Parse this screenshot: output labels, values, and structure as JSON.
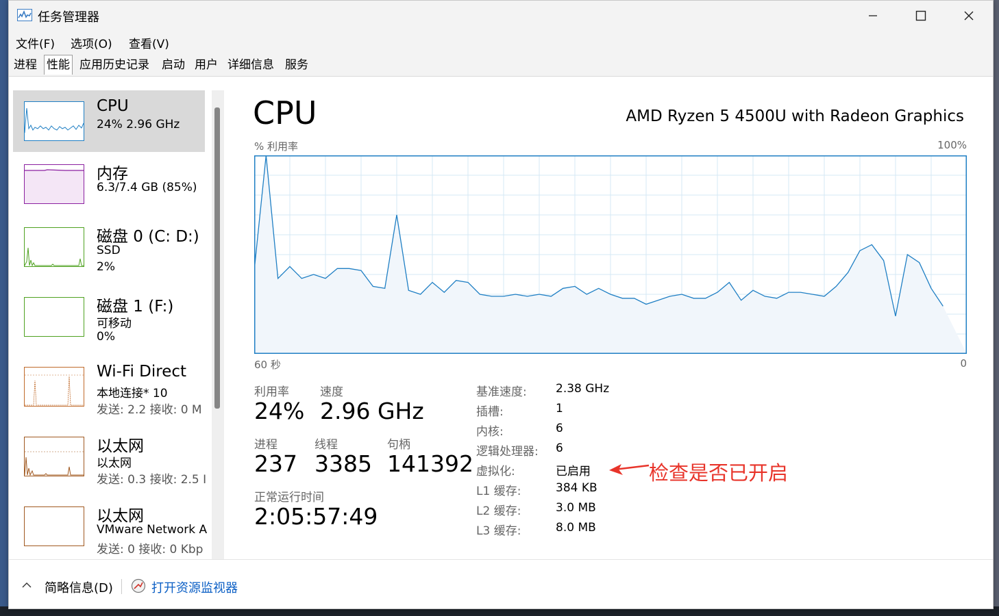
{
  "window": {
    "title": "任务管理器",
    "controls": [
      "minimize-icon",
      "maximize-icon",
      "close-icon"
    ]
  },
  "menu": [
    {
      "label": "文件(F)"
    },
    {
      "label": "选项(O)"
    },
    {
      "label": "查看(V)"
    }
  ],
  "tabs": [
    {
      "label": "进程"
    },
    {
      "label": "性能",
      "active": true
    },
    {
      "label": "应用历史记录"
    },
    {
      "label": "启动"
    },
    {
      "label": "用户"
    },
    {
      "label": "详细信息"
    },
    {
      "label": "服务"
    }
  ],
  "sidebar": {
    "items": [
      {
        "name": "CPU",
        "line1": "24%  2.96 GHz",
        "line2": "",
        "color": "#1f7fc4",
        "selected": true
      },
      {
        "name": "内存",
        "line1": "6.3/7.4 GB (85%)",
        "line2": "",
        "color": "#8b1fa0"
      },
      {
        "name": "磁盘 0 (C: D:)",
        "line1": "SSD",
        "line2": "2%",
        "color": "#4ea11f"
      },
      {
        "name": "磁盘 1 (F:)",
        "line1": "可移动",
        "line2": "0%",
        "color": "#4ea11f"
      },
      {
        "name": "Wi-Fi Direct",
        "line1": "本地连接* 10",
        "line2": "发送: 2.2  接收: 0 M",
        "color": "#c06a2a"
      },
      {
        "name": "以太网",
        "line1": "以太网",
        "line2": "发送: 0.3  接收: 2.5 I",
        "color": "#a0581f"
      },
      {
        "name": "以太网",
        "line1": "VMware Network A",
        "line2": "发送: 0  接收: 0 Kbp",
        "color": "#a0581f"
      }
    ]
  },
  "main": {
    "title": "CPU",
    "model": "AMD Ryzen 5 4500U with Radeon Graphics",
    "graph": {
      "y_label": "% 利用率",
      "y_max_label": "100%",
      "x_left_label": "60 秒",
      "x_right_label": "0",
      "line_color": "#1f7fc4",
      "fill_color": "#f1f6fb",
      "grid_color": "#d6e8f4"
    },
    "stats": {
      "util_label": "利用率",
      "util_value": "24%",
      "speed_label": "速度",
      "speed_value": "2.96 GHz",
      "proc_label": "进程",
      "proc_value": "237",
      "thread_label": "线程",
      "thread_value": "3385",
      "handle_label": "句柄",
      "handle_value": "141392",
      "uptime_label": "正常运行时间",
      "uptime_value": "2:05:57:49"
    },
    "details": [
      {
        "key": "基准速度:",
        "value": "2.38 GHz"
      },
      {
        "key": "插槽:",
        "value": "1"
      },
      {
        "key": "内核:",
        "value": "6"
      },
      {
        "key": "逻辑处理器:",
        "value": "6"
      },
      {
        "key": "虚拟化:",
        "value": "已启用"
      },
      {
        "key": "L1 缓存:",
        "value": "384 KB"
      },
      {
        "key": "L2 缓存:",
        "value": "3.0 MB"
      },
      {
        "key": "L3 缓存:",
        "value": "8.0 MB"
      }
    ],
    "annotation": {
      "text": "检查是否已开启",
      "color": "#e8342a"
    }
  },
  "footer": {
    "fewer_details": "简略信息(D)",
    "open_monitor": "打开资源监视器"
  },
  "chart_data": {
    "type": "area",
    "x": [
      60,
      59,
      58,
      57,
      56,
      55,
      54,
      53,
      52,
      51,
      50,
      49,
      48,
      47,
      46,
      45,
      44,
      43,
      42,
      41,
      40,
      39,
      38,
      37,
      36,
      35,
      34,
      33,
      32,
      31,
      30,
      29,
      28,
      27,
      26,
      25,
      24,
      23,
      22,
      21,
      20,
      19,
      18,
      17,
      16,
      15,
      14,
      13,
      12,
      11,
      10,
      9,
      8,
      7,
      6,
      5,
      4,
      3,
      2,
      1,
      0
    ],
    "values": [
      42,
      100,
      38,
      44,
      38,
      40,
      38,
      43,
      43,
      42,
      34,
      33,
      70,
      32,
      30,
      36,
      31,
      37,
      36,
      30,
      29,
      29,
      30,
      29,
      30,
      29,
      33,
      34,
      30,
      33,
      30,
      28,
      28,
      25,
      27,
      29,
      30,
      28,
      28,
      31,
      36,
      27,
      32,
      29,
      28,
      31,
      31,
      30,
      29,
      34,
      41,
      52,
      55,
      47,
      19,
      50,
      46,
      33,
      24
    ],
    "xlabel": "60 秒",
    "ylabel": "% 利用率",
    "ylim": [
      0,
      100
    ],
    "xlim": [
      60,
      0
    ]
  }
}
